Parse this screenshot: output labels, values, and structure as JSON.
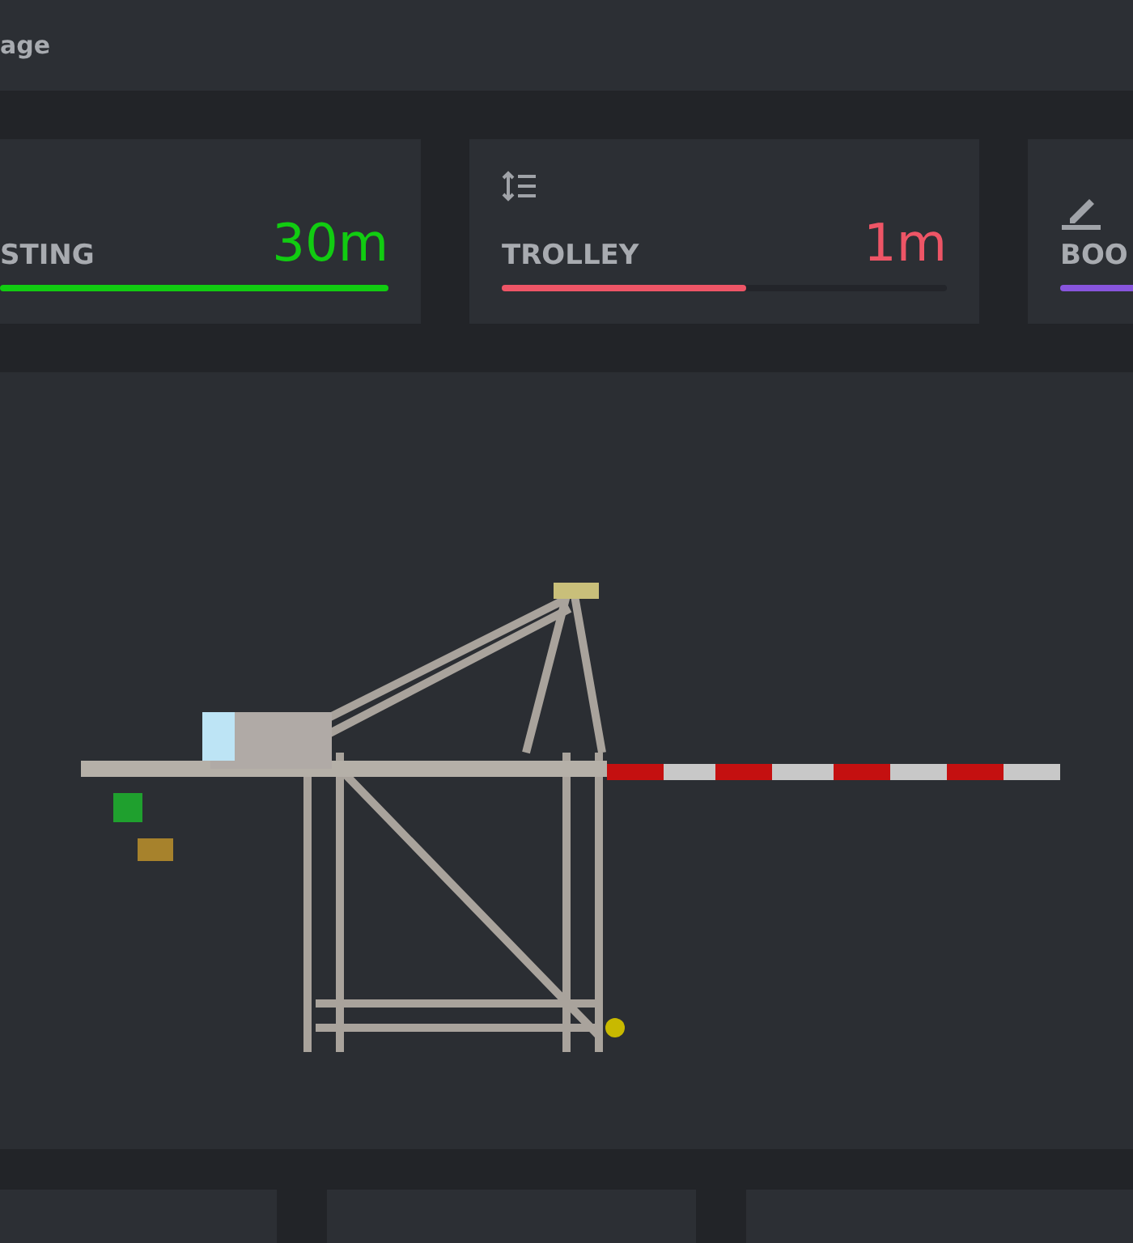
{
  "header": {
    "title": "age"
  },
  "gauges": [
    {
      "kind": "plain",
      "label": "STING",
      "reading": "30m",
      "level": 1.0,
      "color": "#11cc11"
    },
    {
      "kind": "height",
      "label": "TROLLEY",
      "reading": "1m",
      "level": 0.55,
      "color": "#ee5566"
    },
    {
      "kind": "edit",
      "label": "BOO",
      "level": 1.0,
      "color": "#8855dd"
    }
  ],
  "bottom_cards": [
    {
      "kind": "card"
    },
    {
      "kind": "card"
    },
    {
      "kind": "card"
    }
  ]
}
